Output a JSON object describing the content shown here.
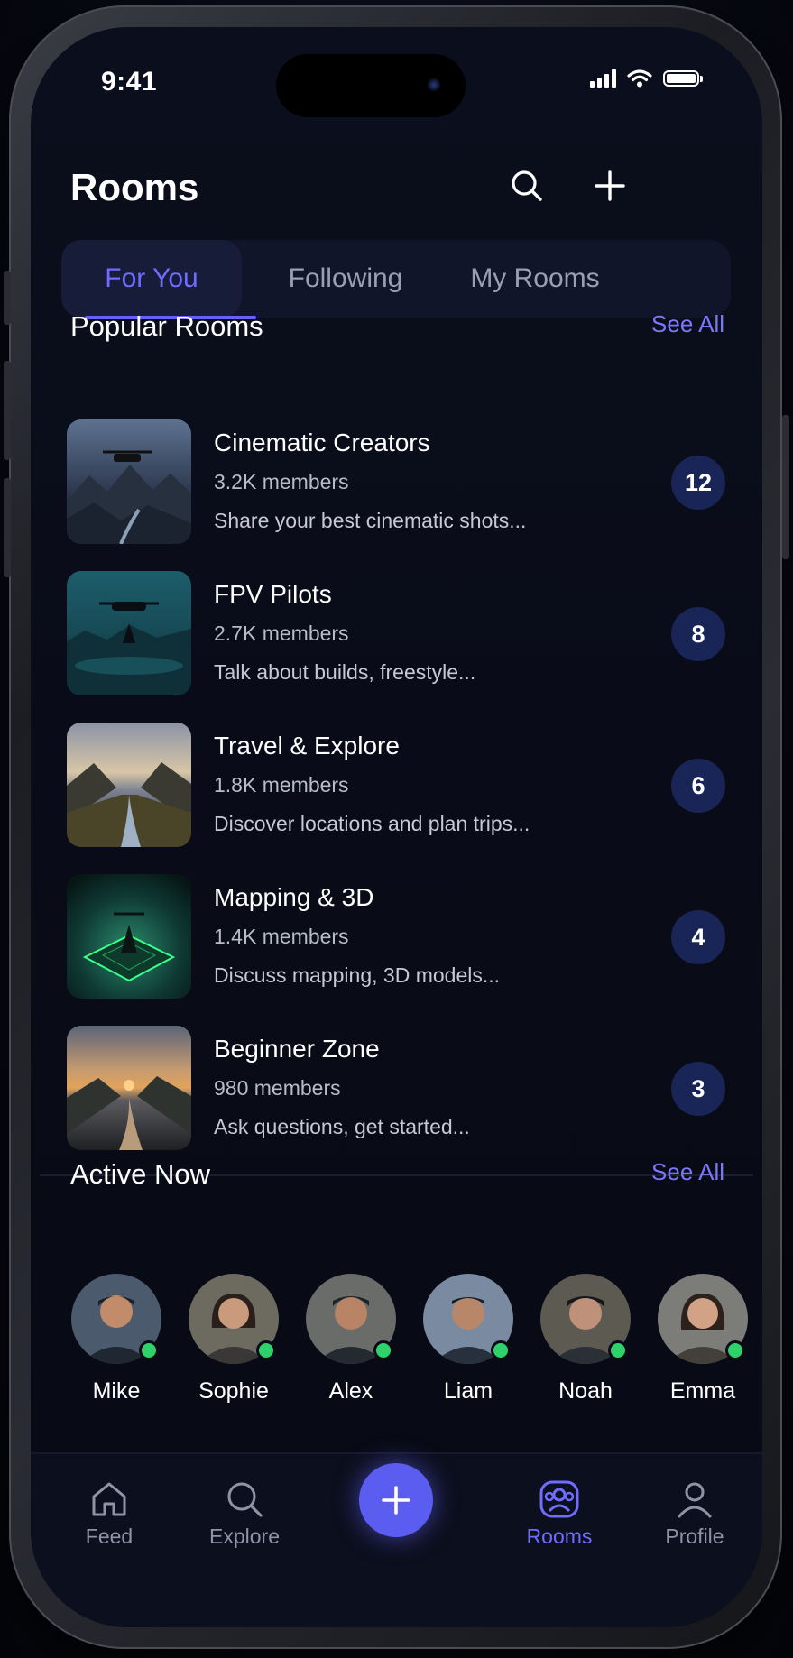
{
  "status_bar": {
    "time": "9:41"
  },
  "header": {
    "title": "Rooms",
    "search_icon": "search-icon",
    "add_icon": "plus-icon"
  },
  "tabs": [
    {
      "label": "For You",
      "active": true
    },
    {
      "label": "Following",
      "active": false
    },
    {
      "label": "My Rooms",
      "active": false
    }
  ],
  "popular_rooms": {
    "title": "Popular Rooms",
    "see_all": "See All",
    "items": [
      {
        "name": "Cinematic Creators",
        "members": "3.2K members",
        "description": "Share your best cinematic shots...",
        "count": "12"
      },
      {
        "name": "FPV Pilots",
        "members": "2.7K members",
        "description": "Talk about builds, freestyle...",
        "count": "8"
      },
      {
        "name": "Travel & Explore",
        "members": "1.8K members",
        "description": "Discover locations and plan trips...",
        "count": "6"
      },
      {
        "name": "Mapping & 3D",
        "members": "1.4K members",
        "description": "Discuss mapping, 3D models...",
        "count": "4"
      },
      {
        "name": "Beginner Zone",
        "members": "980 members",
        "description": "Ask questions, get started...",
        "count": "3"
      }
    ]
  },
  "active_now": {
    "title": "Active Now",
    "see_all": "See All",
    "users": [
      {
        "name": "Mike",
        "online": true
      },
      {
        "name": "Sophie",
        "online": true
      },
      {
        "name": "Alex",
        "online": true
      },
      {
        "name": "Liam",
        "online": true
      },
      {
        "name": "Noah",
        "online": true
      },
      {
        "name": "Emma",
        "online": true
      }
    ]
  },
  "bottom_nav": {
    "items": [
      {
        "label": "Feed",
        "icon": "home-icon",
        "active": false
      },
      {
        "label": "Explore",
        "icon": "search-icon",
        "active": false
      },
      {
        "label": "Rooms",
        "icon": "rooms-icon",
        "active": true
      },
      {
        "label": "Profile",
        "icon": "profile-icon",
        "active": false
      }
    ],
    "fab_icon": "plus-icon"
  },
  "colors": {
    "accent": "#6f6cff",
    "badge_bg": "#182556",
    "online": "#2fd26a",
    "background": "#090c18"
  }
}
